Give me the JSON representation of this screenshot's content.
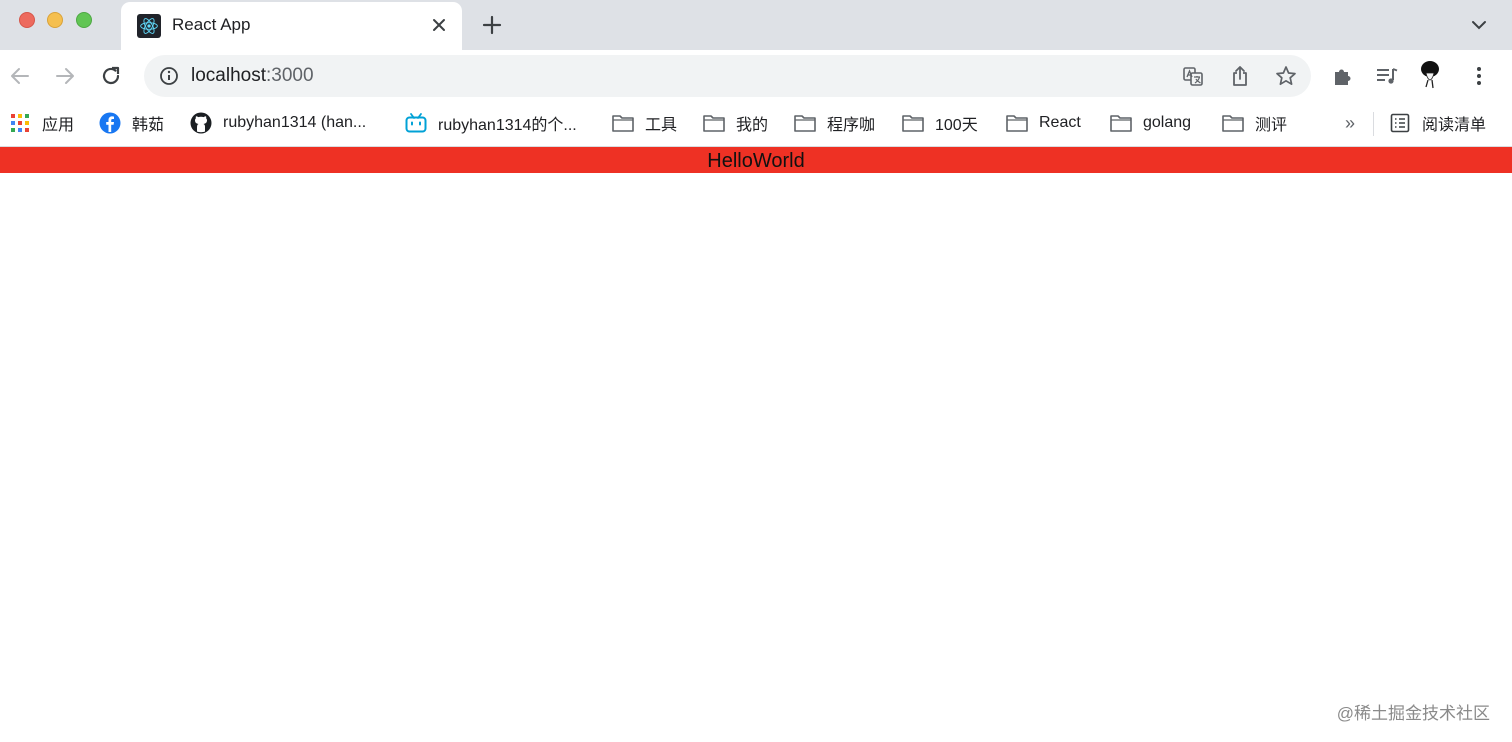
{
  "browser": {
    "tab": {
      "title": "React App",
      "favicon": "react-logo-icon"
    },
    "new_tab": "plus-icon",
    "address_bar": {
      "host": "localhost",
      "port": ":3000"
    },
    "bookmarks": [
      {
        "label": "应用",
        "icon": "apps-grid-icon"
      },
      {
        "label": "韩茹",
        "icon": "facebook-icon"
      },
      {
        "label": "rubyhan1314 (han...",
        "icon": "github-icon"
      },
      {
        "label": "rubyhan1314的个...",
        "icon": "bilibili-icon"
      },
      {
        "label": "工具",
        "icon": "folder-icon"
      },
      {
        "label": "我的",
        "icon": "folder-icon"
      },
      {
        "label": "程序咖",
        "icon": "folder-icon"
      },
      {
        "label": "100天",
        "icon": "folder-icon"
      },
      {
        "label": "React",
        "icon": "folder-icon"
      },
      {
        "label": "golang",
        "icon": "folder-icon"
      },
      {
        "label": "测评",
        "icon": "folder-icon"
      }
    ],
    "bookmarks_overflow": "»",
    "reading_list": "阅读清单"
  },
  "page": {
    "hello_text": "HelloWorld",
    "watermark": "@稀土掘金技术社区"
  },
  "colors": {
    "tabstrip": "#dee1e6",
    "hello_bar": "#ee3124",
    "omnibox": "#f1f3f4"
  }
}
